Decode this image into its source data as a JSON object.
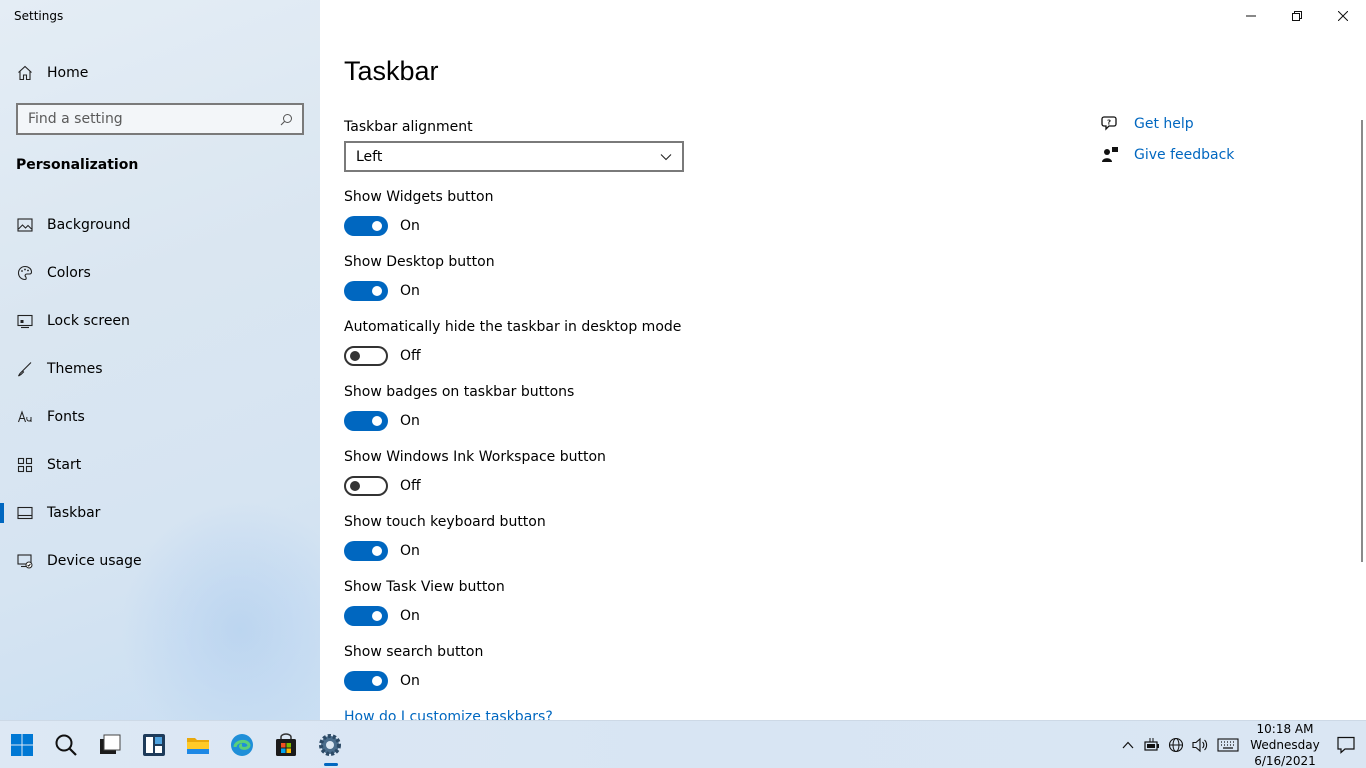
{
  "window": {
    "title": "Settings"
  },
  "sidebar": {
    "home_label": "Home",
    "search_placeholder": "Find a setting",
    "section_title": "Personalization",
    "items": [
      {
        "label": "Background",
        "icon": "picture-icon"
      },
      {
        "label": "Colors",
        "icon": "palette-icon"
      },
      {
        "label": "Lock screen",
        "icon": "lock-screen-icon"
      },
      {
        "label": "Themes",
        "icon": "brush-icon"
      },
      {
        "label": "Fonts",
        "icon": "fonts-icon"
      },
      {
        "label": "Start",
        "icon": "start-grid-icon"
      },
      {
        "label": "Taskbar",
        "icon": "taskbar-icon",
        "active": true
      },
      {
        "label": "Device usage",
        "icon": "device-usage-icon"
      }
    ]
  },
  "main": {
    "title": "Taskbar",
    "alignment": {
      "label": "Taskbar alignment",
      "value": "Left"
    },
    "toggles": [
      {
        "label": "Show Widgets button",
        "state": "On"
      },
      {
        "label": "Show Desktop button",
        "state": "On"
      },
      {
        "label": "Automatically hide the taskbar in desktop mode",
        "state": "Off"
      },
      {
        "label": "Show badges on taskbar buttons",
        "state": "On"
      },
      {
        "label": "Show Windows Ink Workspace button",
        "state": "Off"
      },
      {
        "label": "Show touch keyboard button",
        "state": "On"
      },
      {
        "label": "Show Task View button",
        "state": "On"
      },
      {
        "label": "Show search button",
        "state": "On"
      }
    ],
    "bottom_link": "How do I customize taskbars?",
    "help": {
      "get_help": "Get help",
      "give_feedback": "Give feedback"
    }
  },
  "taskbar": {
    "apps": [
      "start-icon",
      "search-icon",
      "task-view-icon",
      "widgets-icon",
      "file-explorer-icon",
      "edge-icon",
      "store-icon",
      "settings-icon"
    ],
    "clock": {
      "time": "10:18 AM",
      "day": "Wednesday",
      "date": "6/16/2021"
    }
  },
  "colors": {
    "accent": "#0067c0"
  }
}
